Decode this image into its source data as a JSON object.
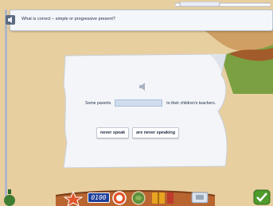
{
  "banner": {
    "question": "What is correct – simple or progressive present?"
  },
  "card": {
    "sentence_start": "Some parents",
    "sentence_end": "to their children's teachers.",
    "options": [
      "never speak",
      "are never speaking"
    ]
  },
  "toolbar": {
    "counter": "0100"
  },
  "colors": {
    "paper": "#f3f5f8",
    "wall": "#e8cfa0",
    "wood": "#b86530",
    "ok": "#4e9a2c"
  }
}
